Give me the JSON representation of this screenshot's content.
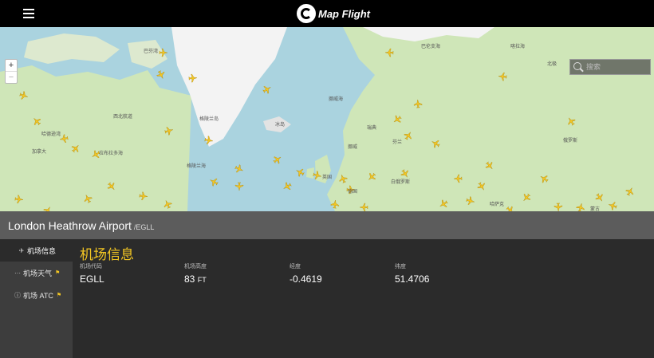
{
  "app": {
    "title": "Map Flight"
  },
  "map": {
    "search_placeholder": "搜索",
    "zoom_in": "+",
    "zoom_out": "−",
    "labels": [
      "巴芬湾",
      "格陵兰岛",
      "冰岛",
      "挪威海",
      "格陵兰海",
      "西北航道",
      "加拿大",
      "哈德逊湾",
      "拉布拉多海",
      "瑞典",
      "芬兰",
      "挪威",
      "英国",
      "德国",
      "俄罗斯",
      "白俄罗斯",
      "巴伦支海",
      "喀拉海",
      "北极",
      "哈萨克",
      "蒙古"
    ]
  },
  "airport": {
    "name": "London Heathrow Airport",
    "separator": "/",
    "code": "EGLL"
  },
  "sidebar": {
    "items": [
      {
        "label": "机场信息",
        "icon": "plane-icon",
        "glyph": "✈"
      },
      {
        "label": "机场天气",
        "icon": "weather-icon",
        "glyph": "···",
        "flag": "⚑"
      },
      {
        "label": "机场 ATC",
        "icon": "info-icon",
        "glyph": "ⓘ",
        "flag": "⚑"
      }
    ]
  },
  "info": {
    "title": "机场信息",
    "fields": [
      {
        "label": "机场代码",
        "value": "EGLL",
        "unit": ""
      },
      {
        "label": "机场高度",
        "value": "83",
        "unit": "FT"
      },
      {
        "label": "经度",
        "value": "-0.4619",
        "unit": ""
      },
      {
        "label": "纬度",
        "value": "51.4706",
        "unit": ""
      }
    ]
  },
  "colors": {
    "accent": "#f3c623",
    "water": "#aad3df",
    "land": "#cfe6b8",
    "ice": "#f3f3f3"
  }
}
